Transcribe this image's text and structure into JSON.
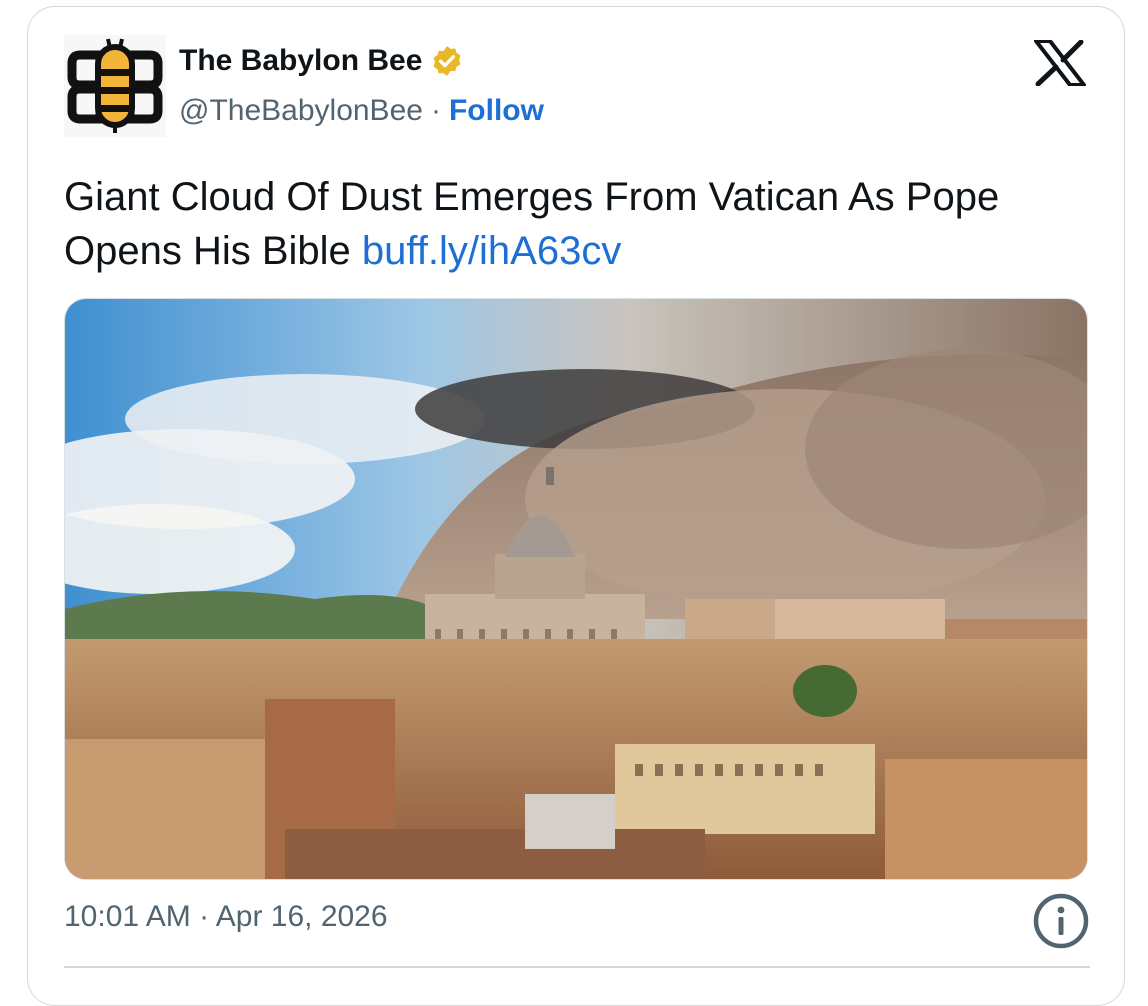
{
  "author": {
    "name": "The Babylon Bee",
    "handle": "@TheBabylonBee",
    "separator": "·",
    "follow_label": "Follow",
    "verified_color": "#e8b829",
    "avatar_icon": "bee-logo-icon"
  },
  "platform_icon": "x-logo-icon",
  "tweet": {
    "text": "Giant Cloud Of Dust Emerges From Vatican As Pope Opens His Bible",
    "link": "buff.ly/ihA63cv"
  },
  "footer": {
    "timestamp": "10:01 AM · Apr 16, 2026",
    "info_icon": "info-icon"
  },
  "colors": {
    "link": "#1d6fd6",
    "text": "#0f1419",
    "muted": "#536471",
    "border": "#cfd9de"
  }
}
